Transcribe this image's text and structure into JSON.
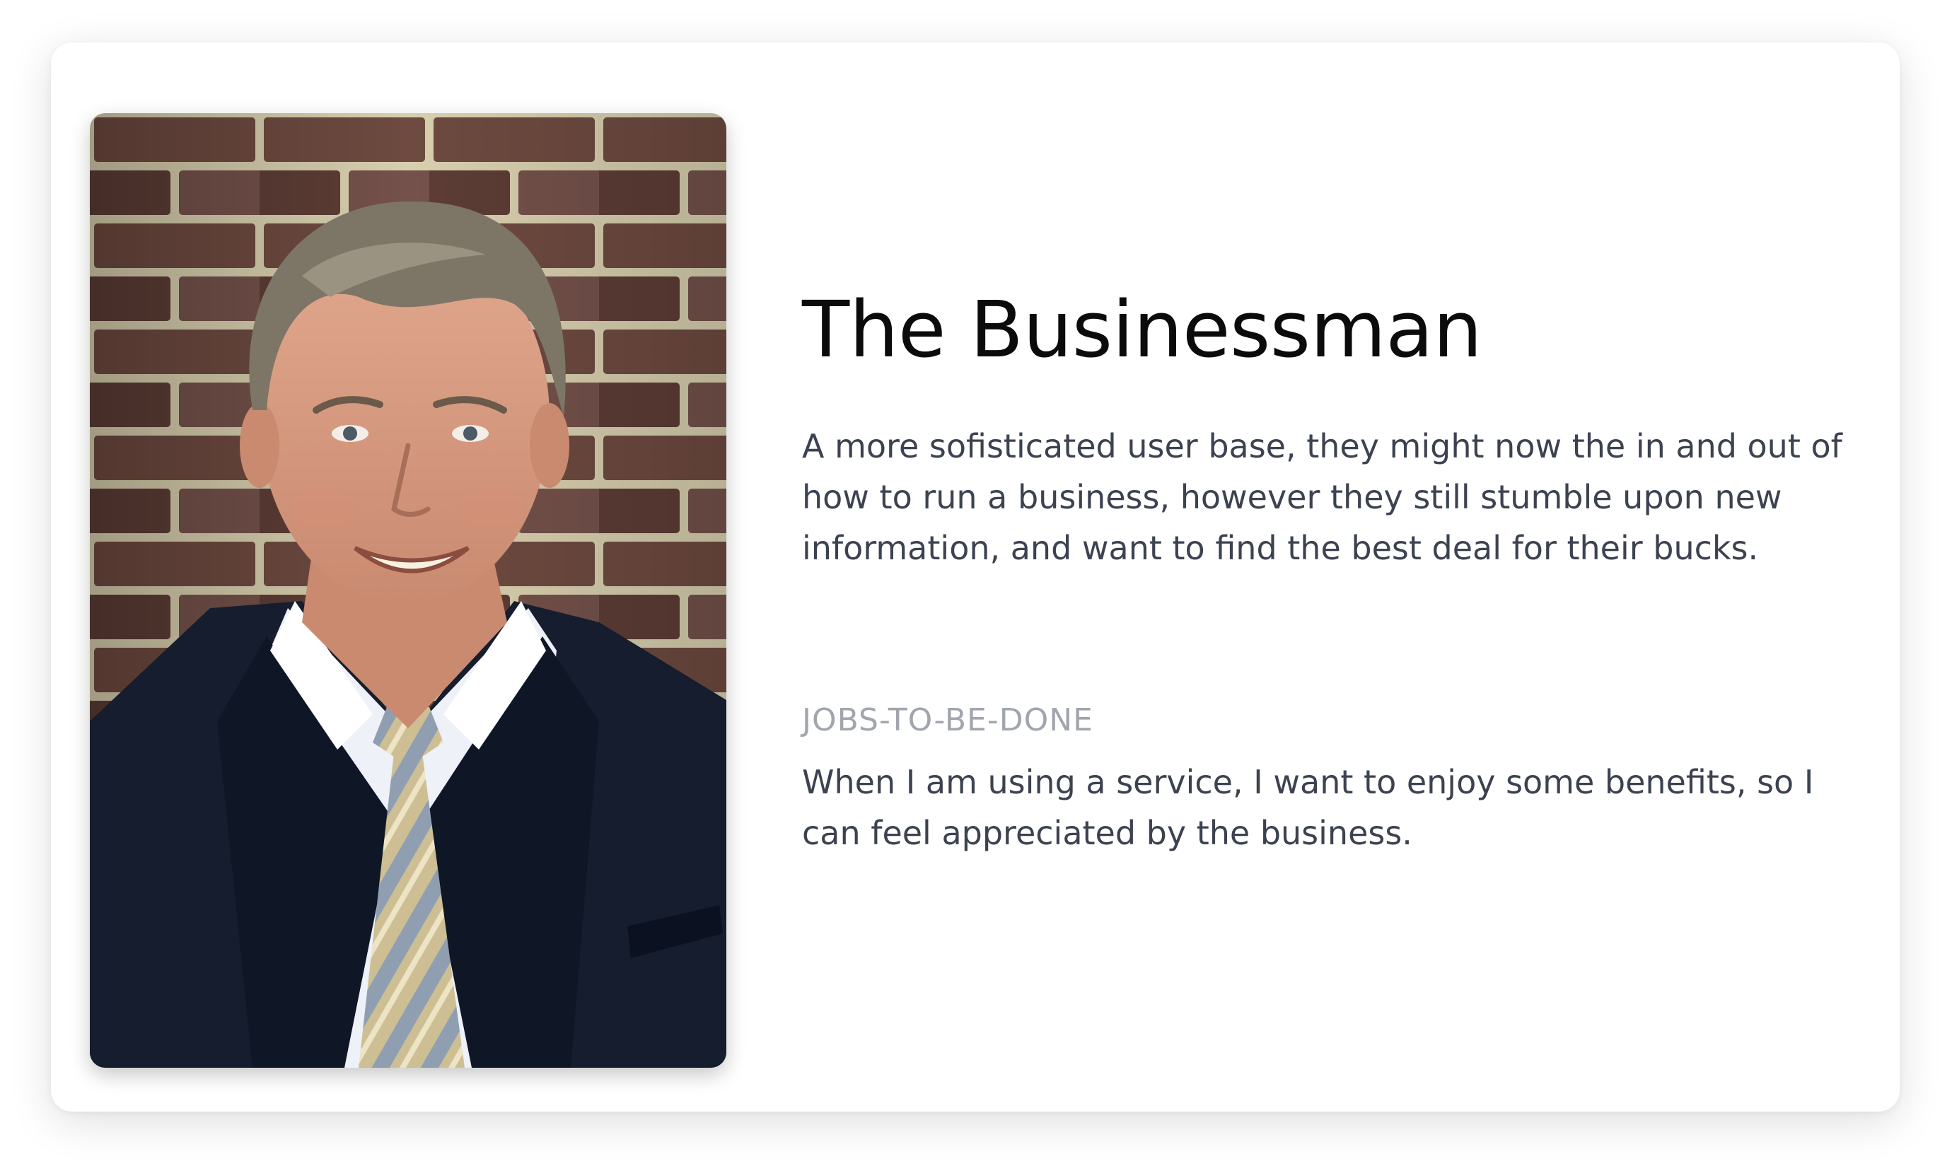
{
  "persona": {
    "title": "The Businessman",
    "description": "A more sofisticated user base, they might now the in and out of how to run a business, however they still stumble upon new information, and want to find the best deal for their bucks.",
    "jtbd_label": "JOBS-TO-BE-DONE",
    "jtbd_text": "When I am using a service, I want to enjoy some benefits, so I can feel appreciated by the business."
  },
  "colors": {
    "title": "#0b0b0b",
    "body_text": "#3c4250",
    "muted_label": "#a1a5ad",
    "card_background": "#ffffff"
  },
  "icons": {
    "portrait": "businessman-portrait-photo"
  }
}
